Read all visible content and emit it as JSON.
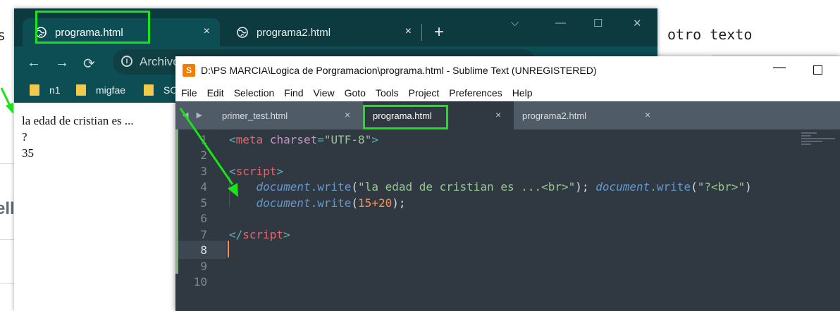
{
  "background": {
    "left_fragment_top": "s",
    "left_fragment_mid": "ell",
    "right_text": "otro texto"
  },
  "chrome": {
    "tabs": [
      {
        "label": "programa.html",
        "close": "×",
        "active": true
      },
      {
        "label": "programa2.html",
        "close": "×",
        "active": false
      }
    ],
    "new_tab": "+",
    "window_controls": {
      "minimize": "—",
      "maximize": "☐",
      "close": "✕",
      "dropdown": "⌵"
    },
    "nav": {
      "back": "←",
      "forward": "→",
      "reload": "⟳"
    },
    "omnibox": {
      "info": "i",
      "text": "Archivo"
    },
    "bookmarks": [
      "n1",
      "migfae",
      "SO"
    ],
    "page_content": [
      "la edad de cristian es ...",
      "?",
      "35"
    ]
  },
  "sublime": {
    "title": "D:\\PS MARCIA\\Logica de Porgramacion\\programa.html - Sublime Text (UNREGISTERED)",
    "icon_letter": "S",
    "window_controls": {
      "minimize": "—"
    },
    "menu": [
      "File",
      "Edit",
      "Selection",
      "Find",
      "View",
      "Goto",
      "Tools",
      "Project",
      "Preferences",
      "Help"
    ],
    "tab_arrows": "◀ ▶",
    "tabs": [
      {
        "label": "primer_test.html",
        "close": "×",
        "active": false
      },
      {
        "label": "programa.html",
        "close": "×",
        "active": true
      },
      {
        "label": "programa2.html",
        "close": "×",
        "active": false
      }
    ],
    "line_numbers": [
      "1",
      "2",
      "3",
      "4",
      "5",
      "6",
      "7",
      "8",
      "9",
      "10"
    ],
    "current_line": 8,
    "code": {
      "l1": {
        "lt": "<",
        "tag": "meta",
        "attr": "charset",
        "eq": "=",
        "val": "\"UTF-8\"",
        "gt": ">"
      },
      "l3": {
        "lt": "<",
        "tag": "script",
        "gt": ">"
      },
      "l4": {
        "obj1": "document",
        "dot1": ".",
        "m1": "write",
        "p1": "(",
        "s1": "\"la edad de cristian es ...<br>\"",
        "p2": ")",
        "semi1": "; ",
        "obj2": "document",
        "dot2": ".",
        "m2": "write",
        "p3": "(",
        "s2": "\"?<br>\"",
        "p4": ")"
      },
      "l5": {
        "obj": "document",
        "dot": ".",
        "m": "write",
        "p1": "(",
        "n1": "15",
        "op": "+",
        "n2": "20",
        "p2": ")",
        "semi": ";"
      },
      "l7": {
        "lt": "</",
        "tag": "script",
        "gt": ">"
      }
    }
  }
}
